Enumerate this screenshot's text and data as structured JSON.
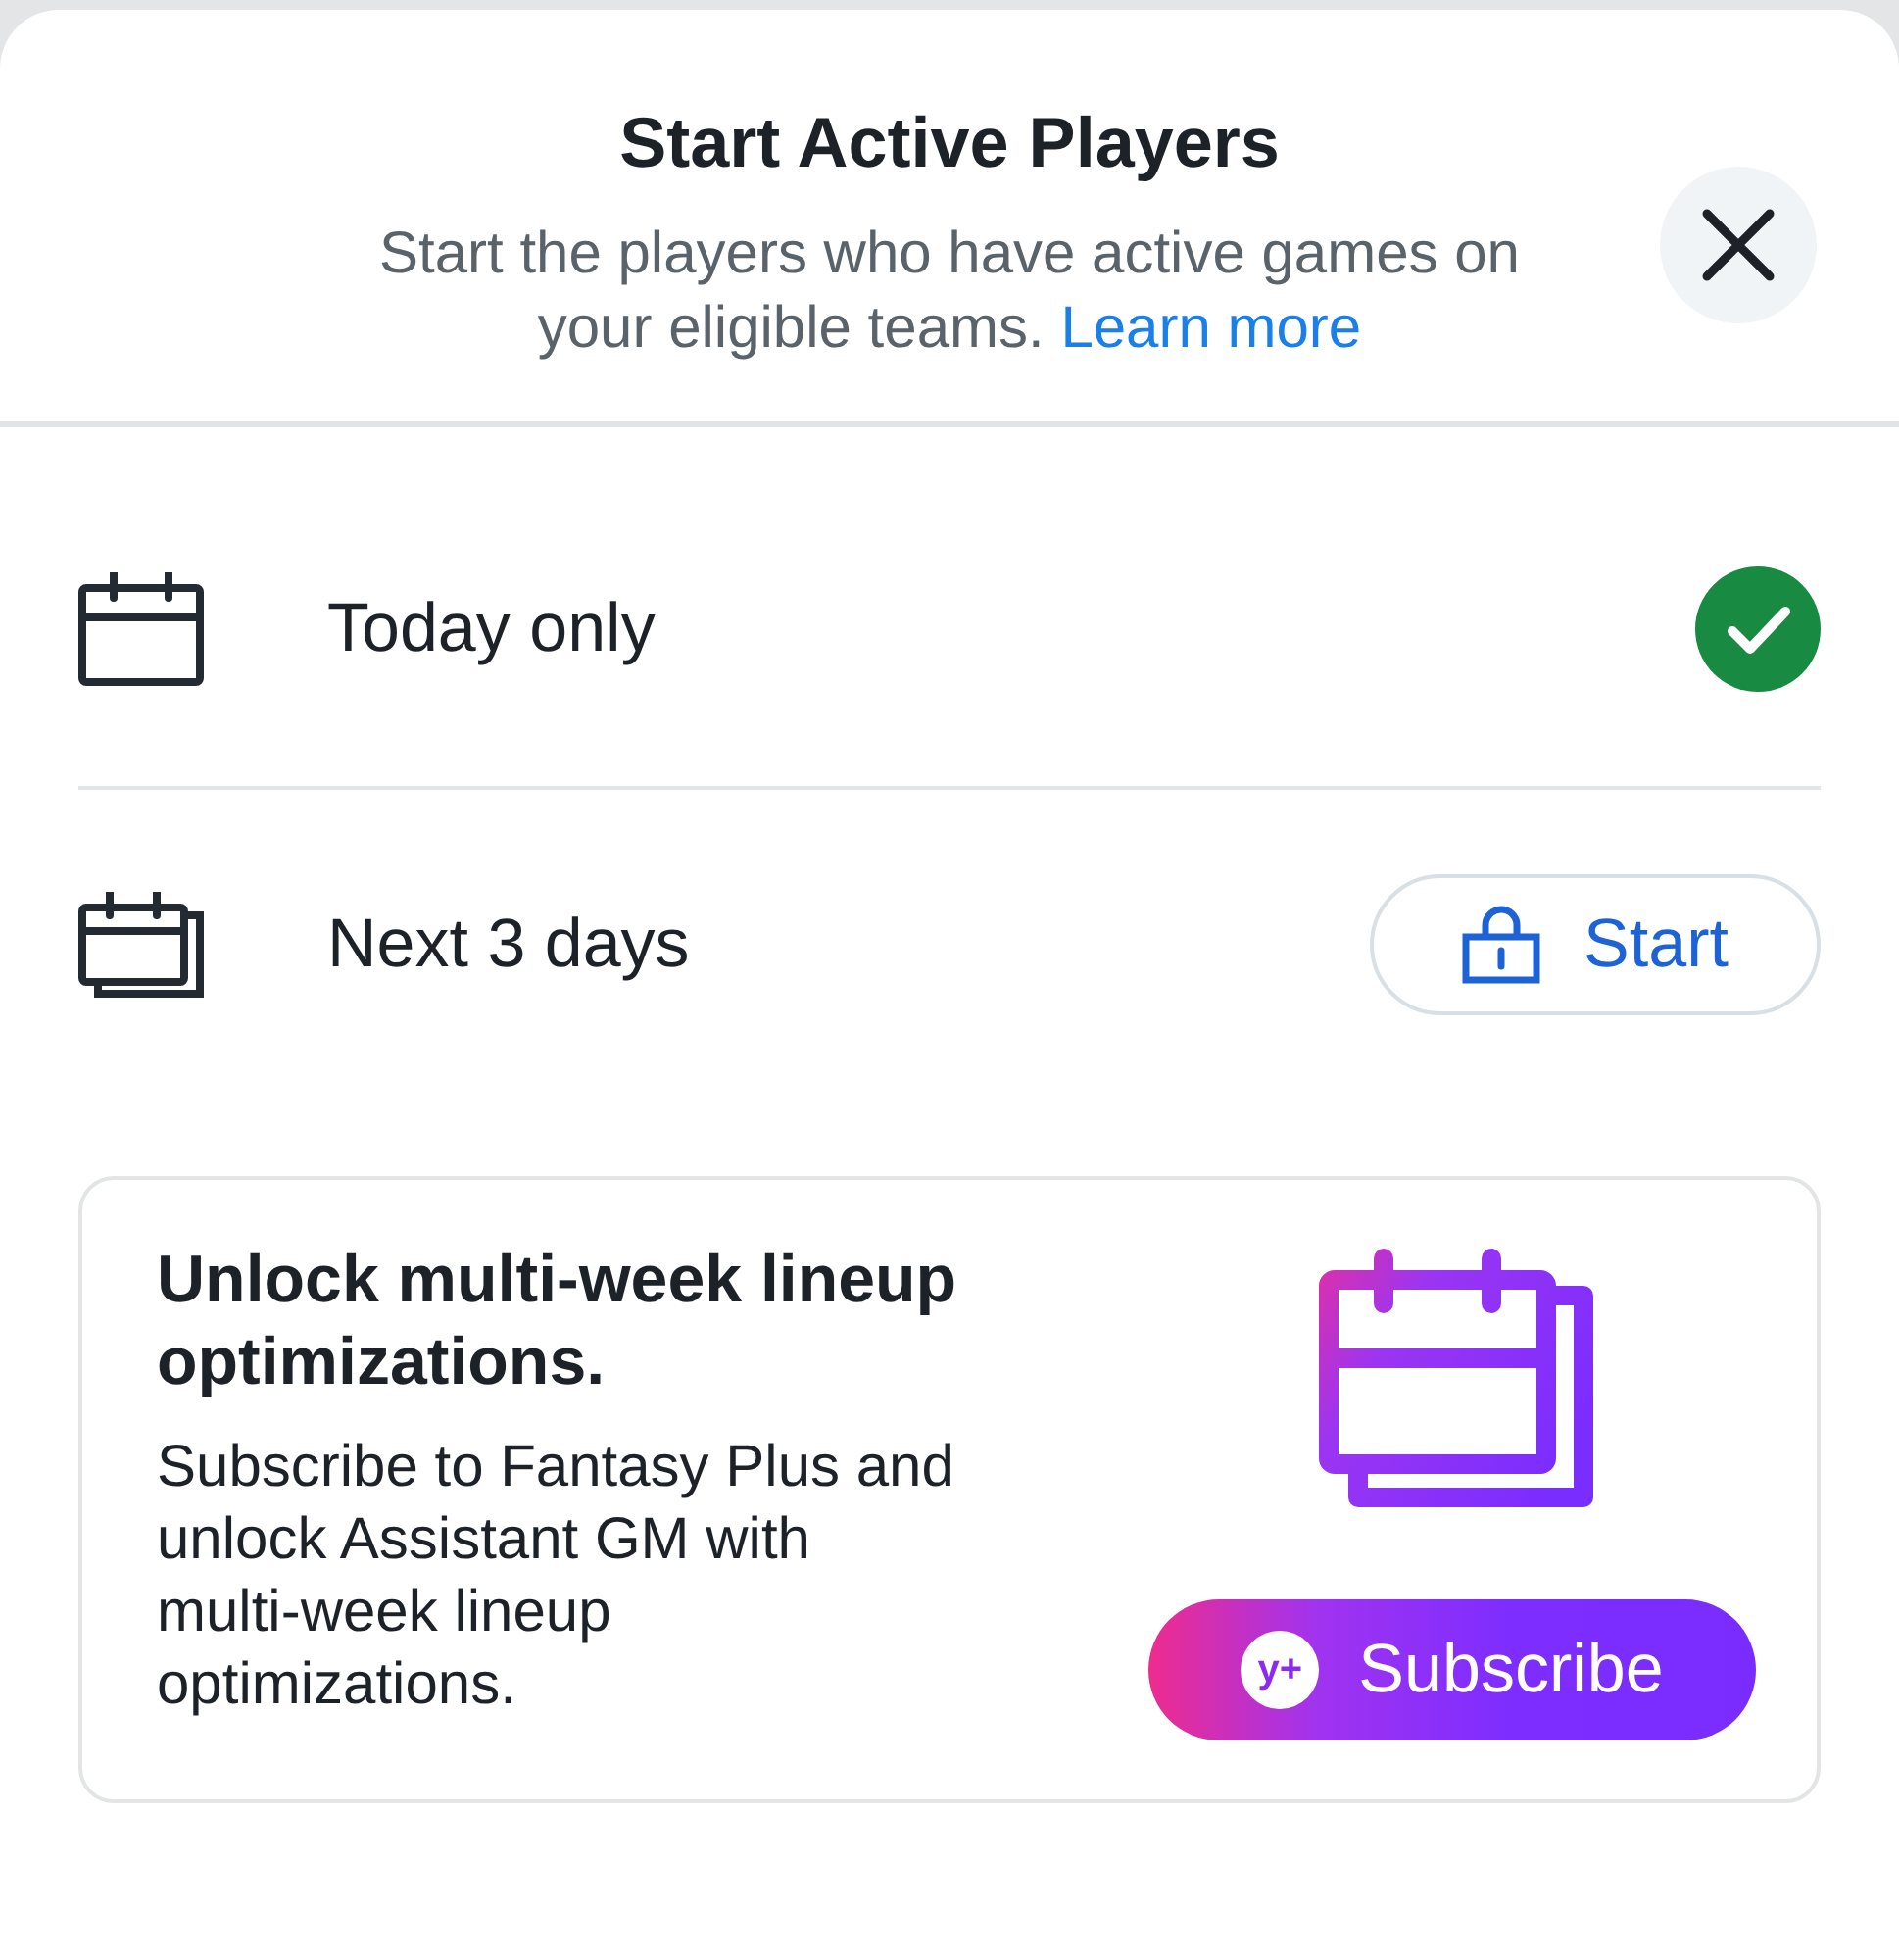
{
  "header": {
    "title": "Start Active Players",
    "subtitle": "Start the players who have active games on your eligible teams.",
    "link": "Learn more"
  },
  "options": [
    {
      "kind": "day",
      "label": "Today only",
      "selected": true
    },
    {
      "kind": "range",
      "label": "Next 3 days",
      "selected": false,
      "locked": true,
      "button": "Start"
    }
  ],
  "promo": {
    "title": "Unlock multi-week lineup optimizations.",
    "body": "Subscribe to Fantasy Plus and unlock Assistant GM with multi-week lineup optimizations.",
    "button": {
      "badge": "y+",
      "label": "Subscribe"
    }
  }
}
